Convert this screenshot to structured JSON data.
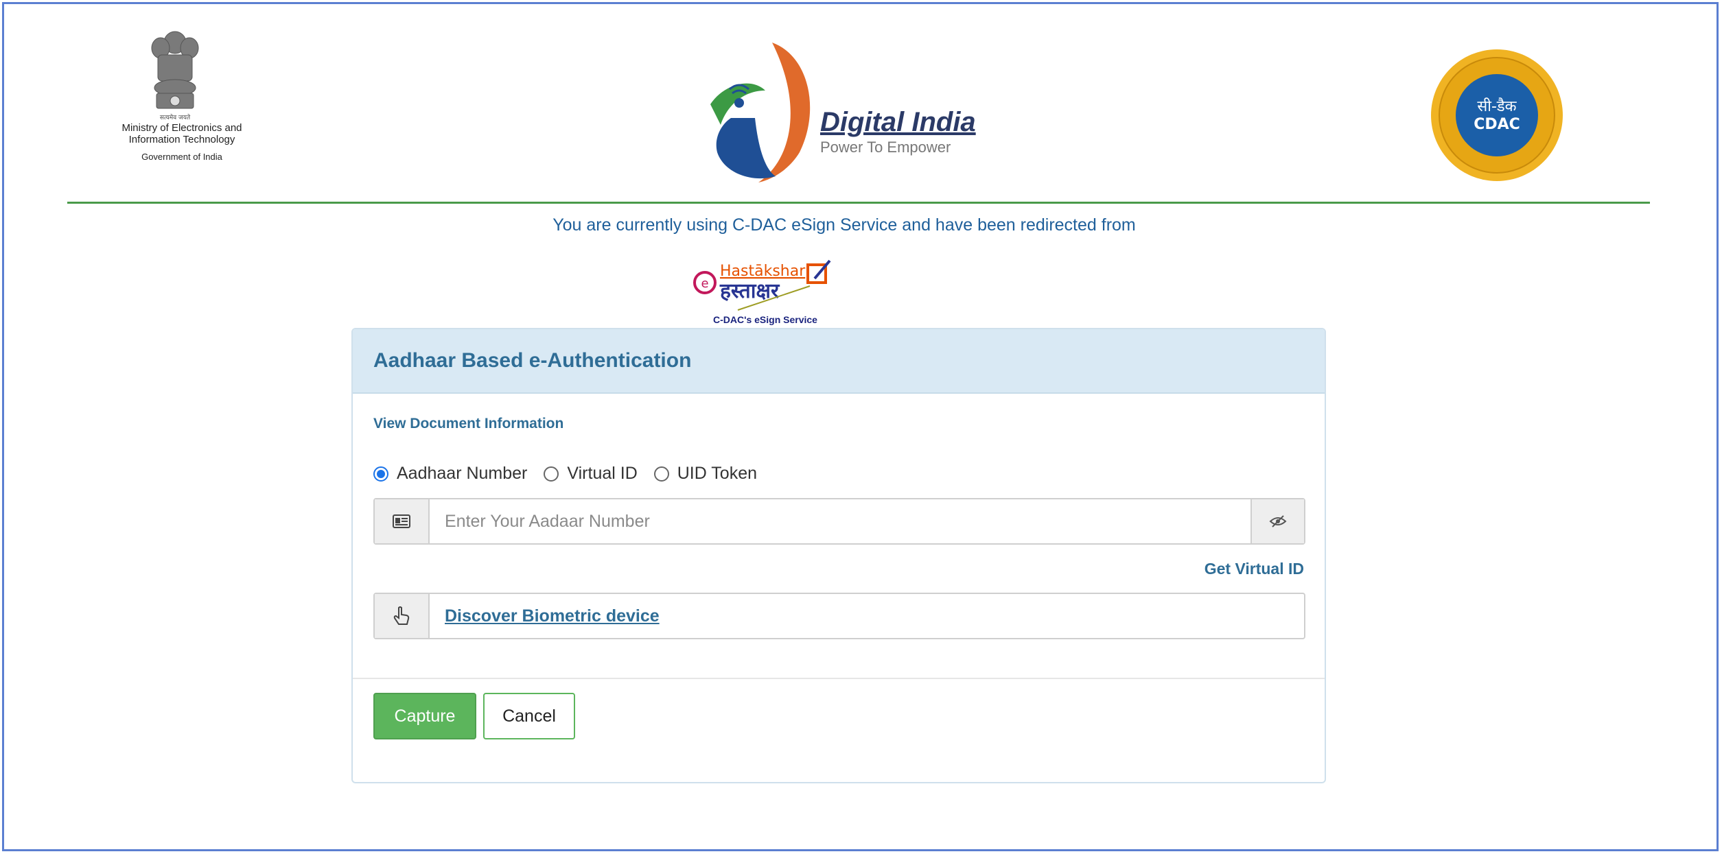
{
  "header": {
    "ministry_lines": [
      "Ministry of Electronics and",
      "Information Technology"
    ],
    "emblem_motto": "सत्यमेव जयते",
    "government": "Government of India",
    "digital_india_title": "Digital India",
    "digital_india_tagline": "Power To Empower",
    "cdac_seal_text": "CDAC",
    "cdac_seal_hindi": "सी-डैक"
  },
  "redirect": {
    "message": "You are currently using C-DAC eSign Service and have been redirected from",
    "logo_text": "Hastākshar",
    "logo_hindi": "हस्ताक्षर",
    "caption": "C-DAC's eSign Service"
  },
  "panel": {
    "title": "Aadhaar Based e-Authentication",
    "view_document": "View Document Information",
    "id_options": [
      {
        "label": "Aadhaar Number",
        "checked": true
      },
      {
        "label": "Virtual ID",
        "checked": false
      },
      {
        "label": "UID Token",
        "checked": false
      }
    ],
    "aadhaar_placeholder": "Enter Your Aadaar Number",
    "get_virtual_id": "Get Virtual ID",
    "discover_biometric": "Discover Biometric device",
    "capture_label": "Capture",
    "cancel_label": "Cancel"
  },
  "colors": {
    "accent_blue": "#2f6d96",
    "panel_head_bg": "#d9e9f4",
    "capture_green": "#5cb55c",
    "divider_green": "#4a9a4a"
  }
}
